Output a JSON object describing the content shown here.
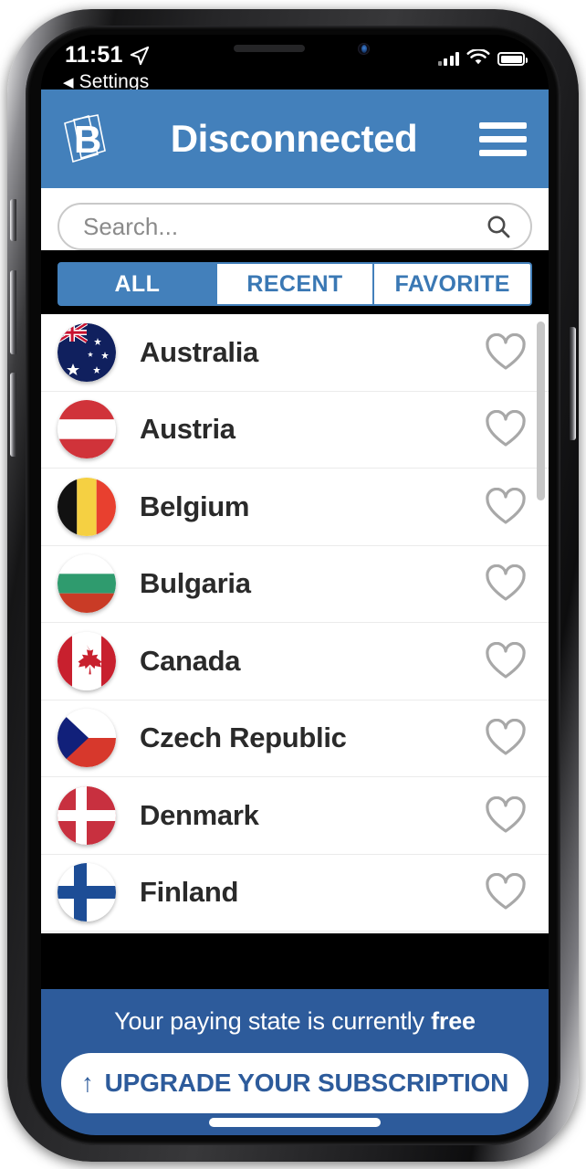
{
  "status_bar": {
    "time": "11:51",
    "location_icon": "location-arrow-icon",
    "back_label": "Settings",
    "back_icon": "back-chevron-icon",
    "signal_icon": "cellular-signal-icon",
    "wifi_icon": "wifi-icon",
    "battery_icon": "battery-icon"
  },
  "header": {
    "logo_icon": "brand-b-logo",
    "title": "Disconnected",
    "menu_icon": "hamburger-menu-icon",
    "background_color": "#4380bb"
  },
  "search": {
    "placeholder": "Search...",
    "value": "",
    "icon": "search-icon"
  },
  "tabs": [
    {
      "label": "ALL",
      "active": true
    },
    {
      "label": "RECENT",
      "active": false
    },
    {
      "label": "FAVORITE",
      "active": false
    }
  ],
  "countries": [
    {
      "name": "Australia",
      "flag": "flag-australia",
      "favorite": false
    },
    {
      "name": "Austria",
      "flag": "flag-austria",
      "favorite": false
    },
    {
      "name": "Belgium",
      "flag": "flag-belgium",
      "favorite": false
    },
    {
      "name": "Bulgaria",
      "flag": "flag-bulgaria",
      "favorite": false
    },
    {
      "name": "Canada",
      "flag": "flag-canada",
      "favorite": false
    },
    {
      "name": "Czech Republic",
      "flag": "flag-czech-republic",
      "favorite": false
    },
    {
      "name": "Denmark",
      "flag": "flag-denmark",
      "favorite": false
    },
    {
      "name": "Finland",
      "flag": "flag-finland",
      "favorite": false
    }
  ],
  "banner": {
    "paying_state_prefix": "Your paying state is currently ",
    "paying_state_value": "free",
    "upgrade_label": "UPGRADE YOUR SUBSCRIPTION",
    "upgrade_icon": "up-arrow-icon",
    "background_color": "#2d5b9b"
  }
}
